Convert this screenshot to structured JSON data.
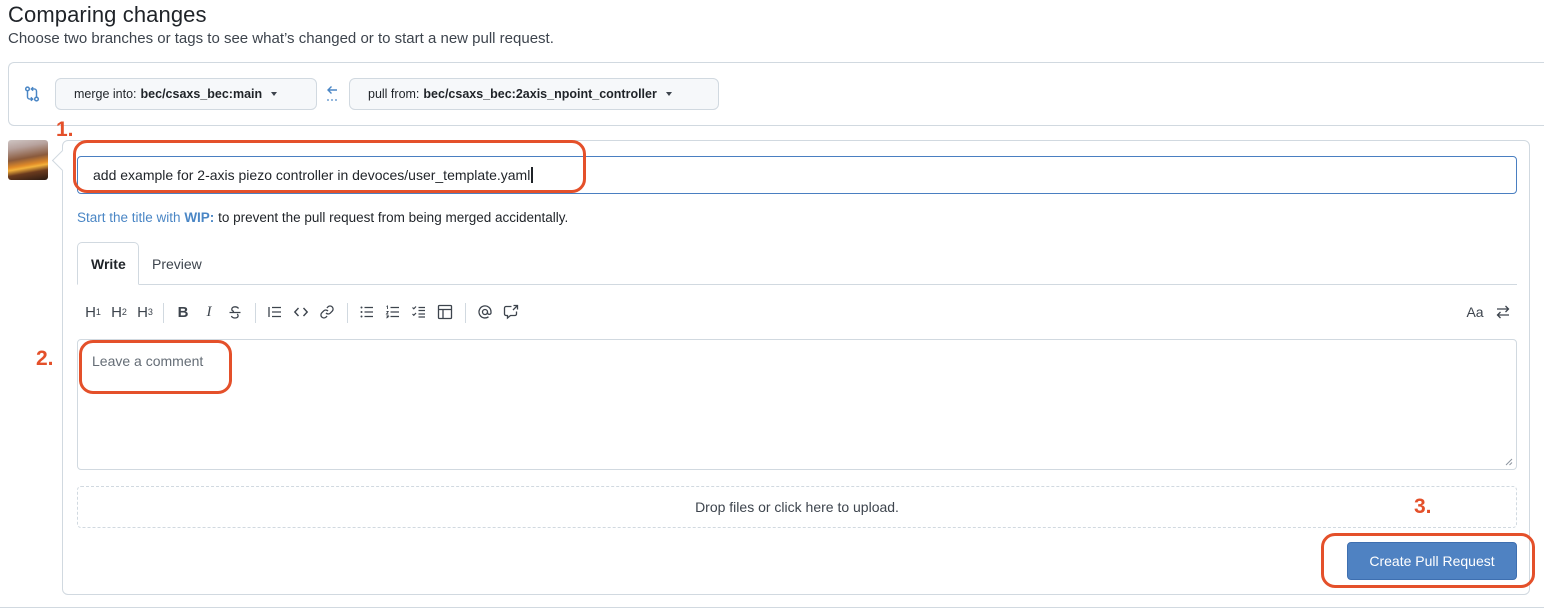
{
  "page": {
    "title": "Comparing changes",
    "subtitle": "Choose two branches or tags to see what’s changed or to start a new pull request."
  },
  "compare": {
    "base_label": "merge into:",
    "base_value": "bec/csaxs_bec:main",
    "head_label": "pull from:",
    "head_value": "bec/csaxs_bec:2axis_npoint_controller"
  },
  "form": {
    "title_value": "add example for 2-axis piezo controller in devoces/user_template.yaml",
    "hint_link": "Start the title with",
    "hint_wip": "WIP:",
    "hint_text": " to prevent the pull request from being merged accidentally.",
    "tabs": [
      "Write",
      "Preview"
    ],
    "toolbar": {
      "h1": "H",
      "h1_sub": "1",
      "h2": "H",
      "h2_sub": "2",
      "h3": "H",
      "h3_sub": "3",
      "bold": "B",
      "italic": "I",
      "text_size": "Aa"
    },
    "comment_placeholder": "Leave a comment",
    "drop_text": "Drop files or click here to upload.",
    "submit_label": "Create Pull Request"
  },
  "annotations": [
    "1.",
    "2.",
    "3."
  ],
  "colors": {
    "accent": "#4f82c2",
    "annotation": "#e4502a",
    "link": "#4a86c5",
    "border": "#d1d9e0"
  }
}
